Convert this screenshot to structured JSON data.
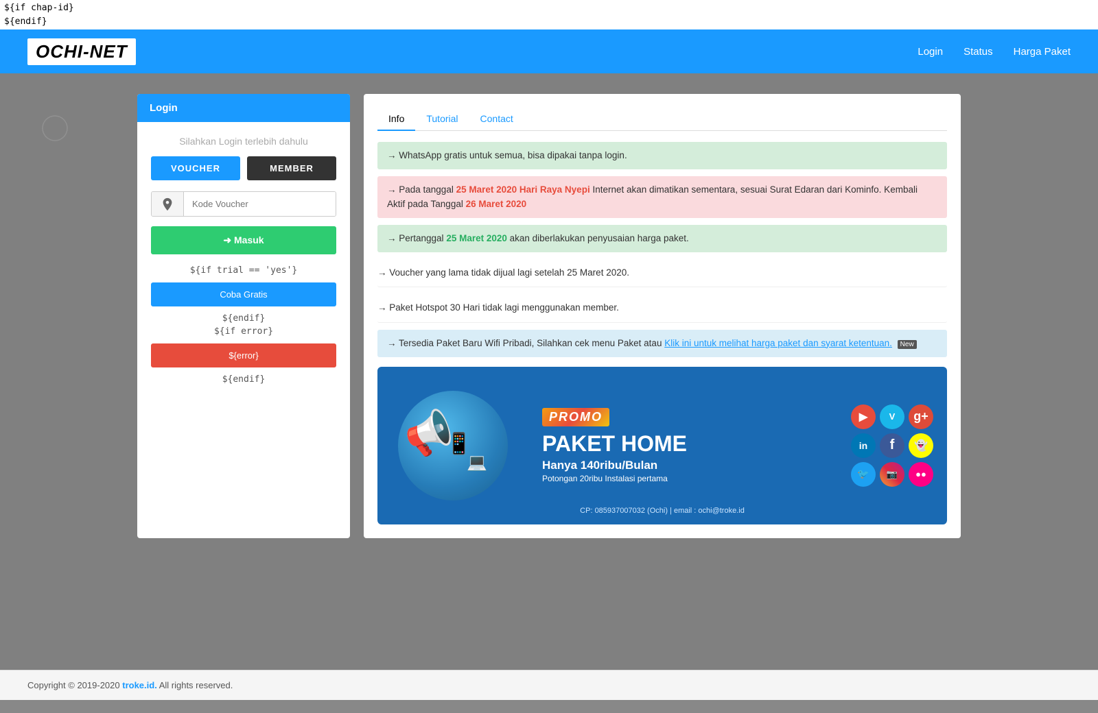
{
  "template_code": {
    "line1": "${if chap-id}",
    "line2": "${endif}"
  },
  "header": {
    "logo": "OCHI-NET",
    "nav": {
      "login": "Login",
      "status": "Status",
      "harga_paket": "Harga Paket"
    }
  },
  "login_panel": {
    "title": "Login",
    "hint": "Silahkan Login terlebih dahulu",
    "btn_voucher": "VOUCHER",
    "btn_member": "MEMBER",
    "input_placeholder": "Kode Voucher",
    "btn_masuk": "➜ Masuk",
    "template_if_trial": "${if trial == 'yes'}",
    "btn_coba": "Coba Gratis",
    "template_endif1": "${endif}",
    "template_if_error": "${if error}",
    "btn_error": "${error}",
    "template_endif2": "${endif}"
  },
  "info_panel": {
    "tabs": [
      {
        "label": "Info",
        "active": true
      },
      {
        "label": "Tutorial",
        "active": false
      },
      {
        "label": "Contact",
        "active": false
      }
    ],
    "items": [
      {
        "type": "green",
        "text": "→ WhatsApp gratis untuk semua, bisa dipakai tanpa login."
      },
      {
        "type": "pink",
        "text_before": "→ Pada tanggal ",
        "highlight": "25 Maret 2020 Hari Raya Nyepi",
        "text_middle": " Internet akan dimatikan sementara, sesuai Surat Edaran dari Kominfo. Kembali Aktif pada Tanggal ",
        "highlight2": "26 Maret 2020",
        "text_after": ""
      },
      {
        "type": "green2",
        "text_before": "→ Pertanggal ",
        "highlight": "25 Maret 2020",
        "text_after": " akan diberlakukan penyusaian harga paket."
      },
      {
        "type": "plain",
        "text": "→ Voucher yang lama tidak dijual lagi setelah 25 Maret 2020."
      },
      {
        "type": "plain",
        "text": "→ Paket Hotspot 30 Hari tidak lagi menggunakan member."
      },
      {
        "type": "blue",
        "text_before": "→ Tersedia Paket Baru Wifi Pribadi, Silahkan cek menu Paket atau ",
        "link_text": "Klik ini untuk melihat harga paket dan syarat ketentuan.",
        "badge": "New"
      }
    ],
    "promo": {
      "label": "PROMO",
      "title": "PAKET HOME",
      "subtitle": "Hanya 140ribu/Bulan",
      "desc": "Potongan 20ribu Instalasi pertama",
      "contact": "CP: 085937007032 (Ochi) | email : ochi@troke.id"
    }
  },
  "footer": {
    "text_before": "Copyright © 2019-2020 ",
    "link_text": "troke.id.",
    "text_after": " All rights reserved."
  }
}
